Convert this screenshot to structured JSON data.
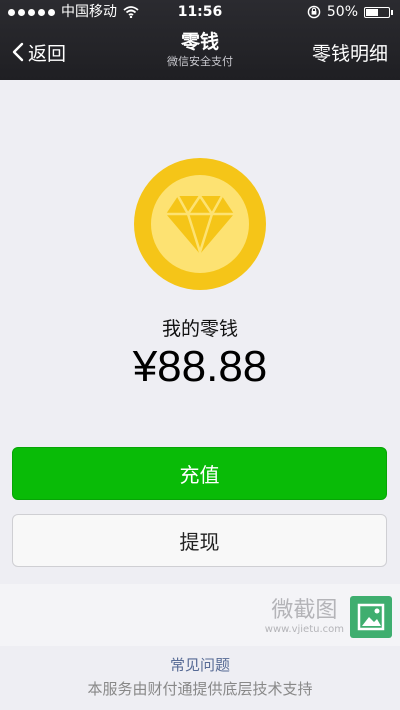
{
  "status_bar": {
    "carrier": "中国移动",
    "time": "11:56",
    "battery": "50%",
    "battery_level": 0.5,
    "icons": [
      "signal-dots-icon",
      "wifi-icon",
      "rotation-lock-icon",
      "battery-icon"
    ]
  },
  "nav": {
    "back_label": "返回",
    "title": "零钱",
    "subtitle": "微信安全支付",
    "right_label": "零钱明细"
  },
  "wallet": {
    "label": "我的零钱",
    "amount": "¥88.88",
    "icon": "diamond-icon"
  },
  "buttons": {
    "recharge": "充值",
    "withdraw": "提现"
  },
  "watermark": {
    "main": "微截图",
    "sub": "www.vjietu.com"
  },
  "footer": {
    "faq": "常见问题",
    "note": "本服务由财付通提供底层技术支持"
  },
  "colors": {
    "nav_bg": "#1f1f23",
    "primary_green": "#09bb07",
    "coin_outer": "#f5c518",
    "coin_inner": "#fde272",
    "link": "#576b95"
  }
}
